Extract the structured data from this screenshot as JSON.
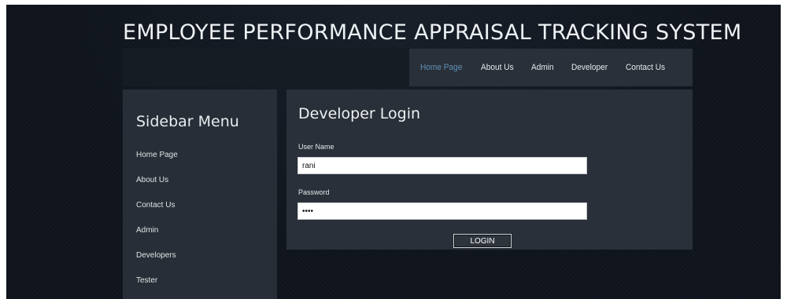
{
  "header": {
    "title": "EMPLOYEE PERFORMANCE APPRAISAL TRACKING SYSTEM"
  },
  "top_nav": {
    "items": [
      {
        "label": "Home Page",
        "active": true
      },
      {
        "label": "About Us",
        "active": false
      },
      {
        "label": "Admin",
        "active": false
      },
      {
        "label": "Developer",
        "active": false
      },
      {
        "label": "Contact Us",
        "active": false
      }
    ]
  },
  "sidebar": {
    "title": "Sidebar Menu",
    "items": [
      {
        "label": "Home Page"
      },
      {
        "label": "About Us"
      },
      {
        "label": "Contact Us"
      },
      {
        "label": "Admin"
      },
      {
        "label": "Developers"
      },
      {
        "label": "Tester"
      }
    ]
  },
  "login": {
    "title": "Developer Login",
    "username_label": "User Name",
    "username_value": "rani",
    "password_label": "Password",
    "password_value": "1234",
    "button_label": "LOGIN"
  },
  "colors": {
    "background": "#0f141c",
    "panel": "#2a3039",
    "active_nav": "#5f8fb5",
    "text": "#e6e9ec"
  }
}
